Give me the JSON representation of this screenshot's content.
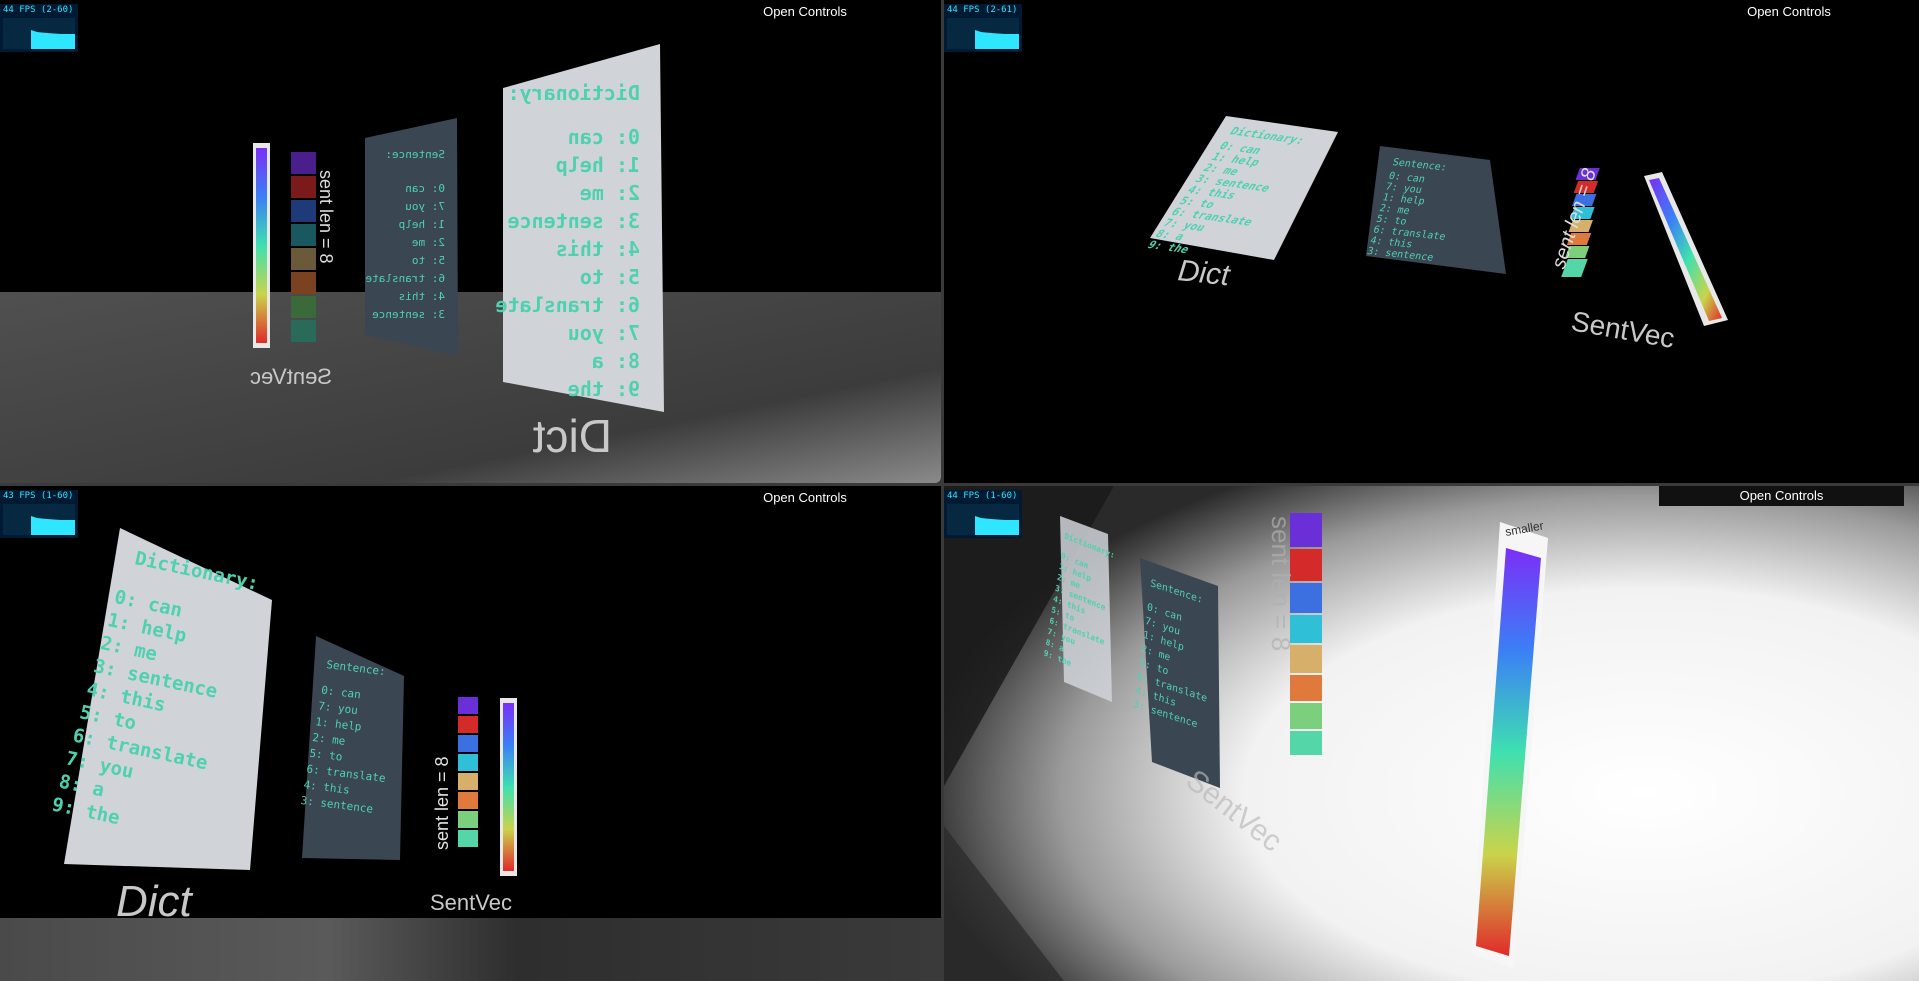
{
  "views": [
    {
      "fps": "44 FPS (2-60)",
      "controls_label": "Open Controls"
    },
    {
      "fps": "44 FPS (2-61)",
      "controls_label": "Open Controls"
    },
    {
      "fps": "43 FPS (1-60)",
      "controls_label": "Open Controls"
    },
    {
      "fps": "44 FPS (1-60)",
      "controls_label": "Open Controls"
    }
  ],
  "scene": {
    "dict_title": "Dictionary:",
    "dict_entries": [
      "0: can",
      "1: help",
      "2: me",
      "3: sentence",
      "4: this",
      "5: to",
      "6: translate",
      "7: you",
      "8: a",
      "9: the"
    ],
    "dict_label": "Dict",
    "sentence_title": "Sentence:",
    "sentence_entries": [
      "0: can",
      "7: you",
      "1: help",
      "2: me",
      "5: to",
      "6: translate",
      "4: this",
      "3: sentence"
    ],
    "sentvec_label": "SentVec",
    "sent_len_label": "sent len = 8",
    "colorbar_label": "smaller"
  },
  "colors": {
    "text_teal": "#4fd1b0",
    "cube_colors": [
      "#6a2fd6",
      "#d42a2a",
      "#3c6fe0",
      "#2fc0d8",
      "#d6b06a",
      "#e07a3c",
      "#7ccf7c",
      "#54d6a8"
    ]
  }
}
